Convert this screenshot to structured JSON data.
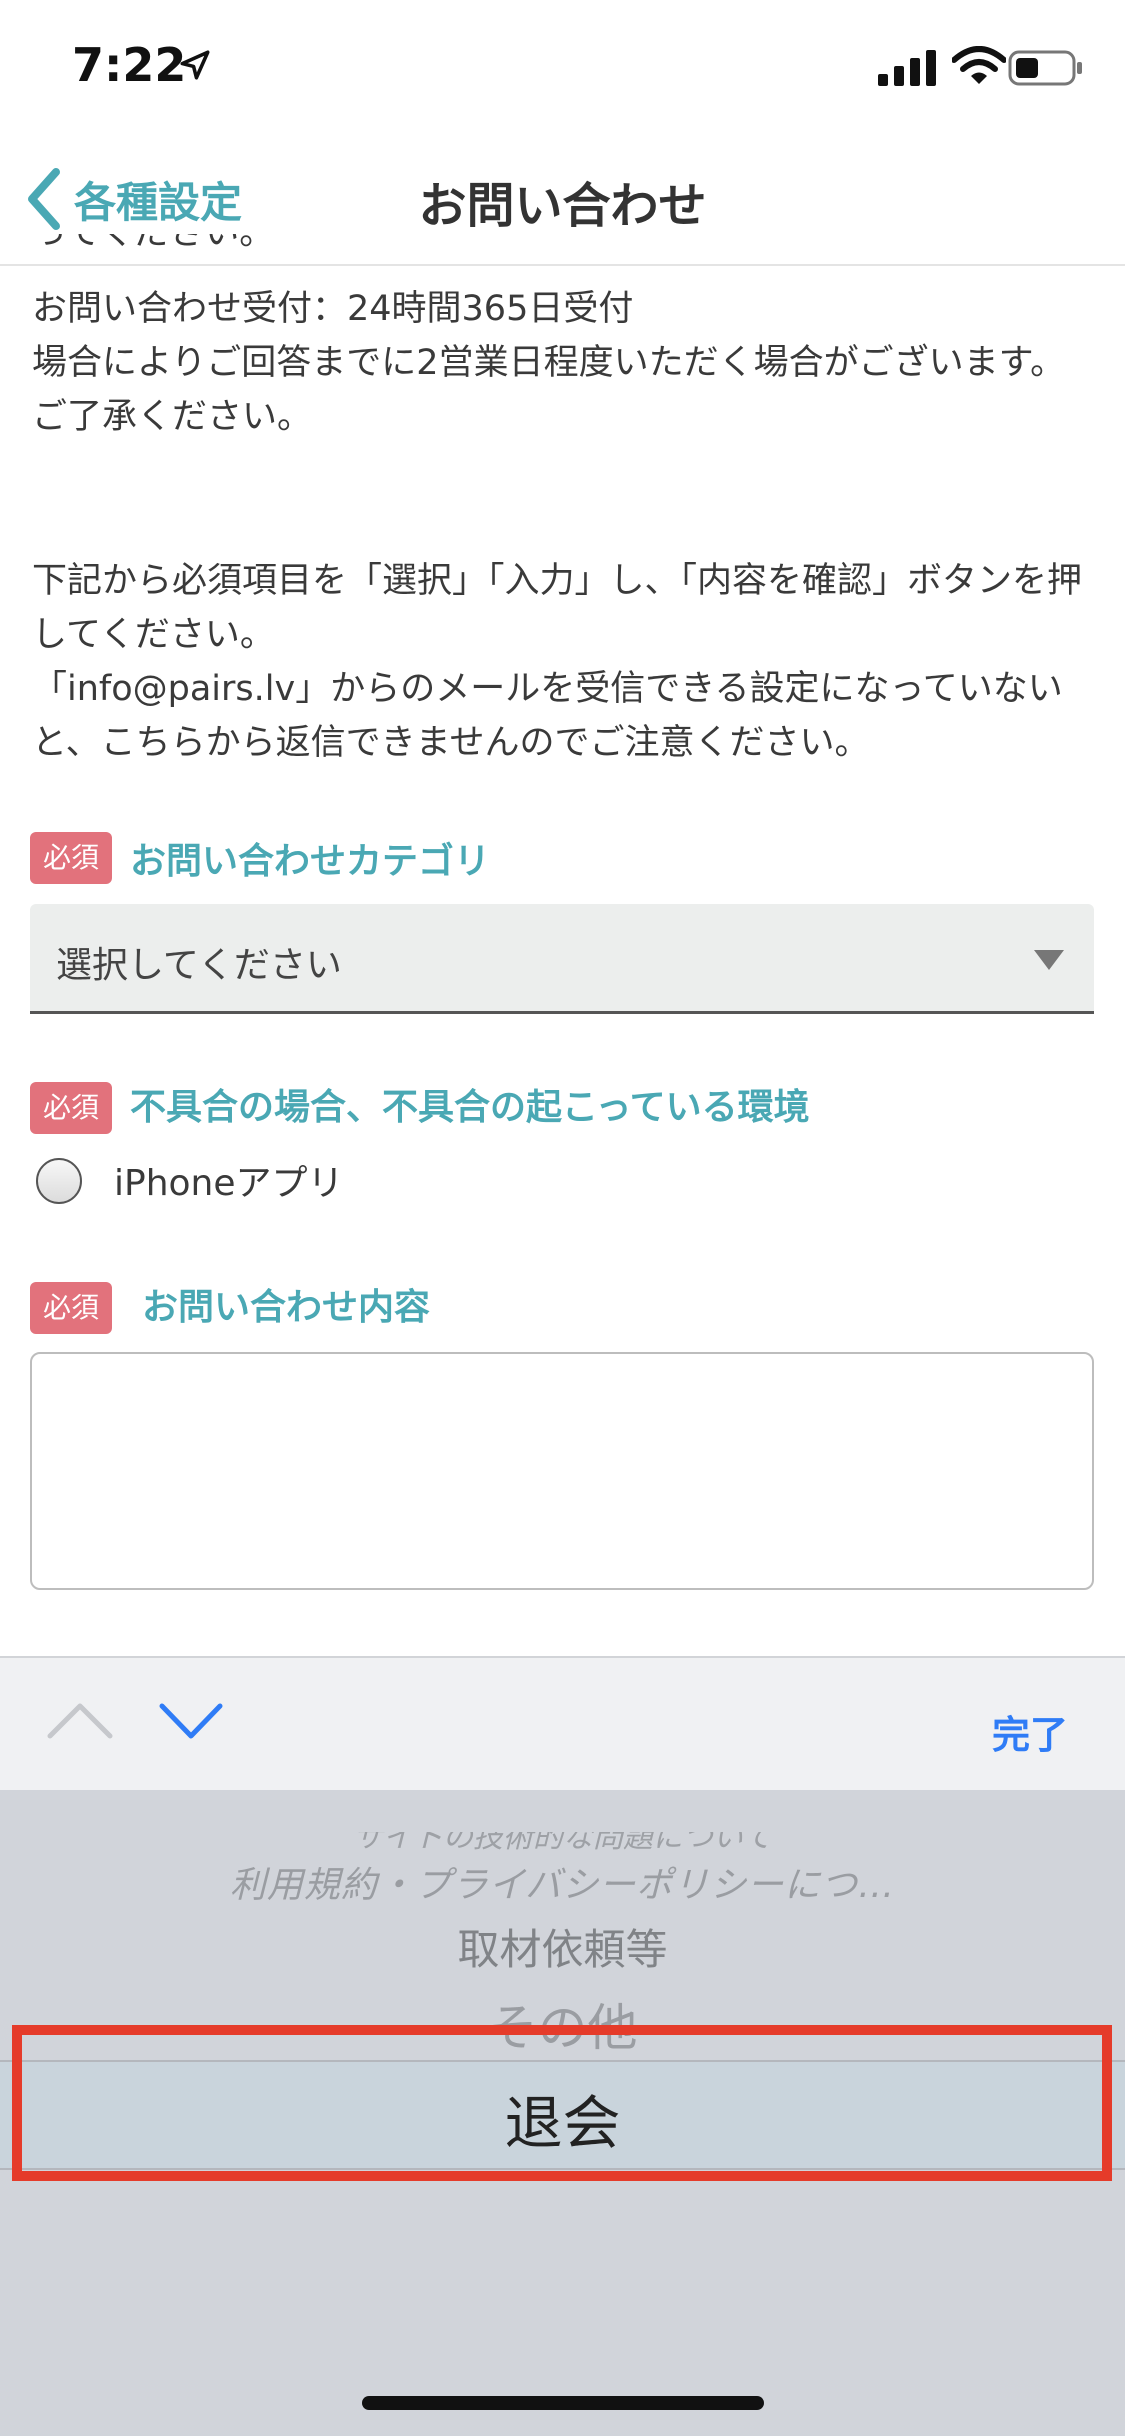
{
  "status_bar": {
    "time": "7:22",
    "icons": [
      "location-arrow-icon",
      "cellular-signal-icon",
      "wifi-icon",
      "battery-icon"
    ]
  },
  "nav": {
    "back_label": "各種設定",
    "title": "お問い合わせ",
    "back_icon": "chevron-left-icon"
  },
  "intro": {
    "cut_line": "ってください。",
    "line1": "お問い合わせ受付：24時間365日受付",
    "line2": "場合によりご回答までに2営業日程度いただく場合がございます。ご了承ください。",
    "paragraph2": "下記から必須項目を「選択」「入力」し、「内容を確認」ボタンを押してください。",
    "paragraph3": "「info@pairs.lv」からのメールを受信できる設定になっていないと、こちらから返信できませんのでご注意ください。"
  },
  "form": {
    "required_badge": "必須",
    "category": {
      "label": "お問い合わせカテゴリ",
      "selected_value": "選択してください"
    },
    "environment": {
      "label": "不具合の場合、不具合の起こっている環境",
      "option_label": "iPhoneアプリ"
    },
    "content": {
      "label": "お問い合わせ内容",
      "value": ""
    }
  },
  "keyboard_accessory": {
    "done_label": "完了",
    "prev_icon": "chevron-up-icon",
    "next_icon": "chevron-down-icon"
  },
  "picker": {
    "options": [
      "サイトの技術的な問題について",
      "利用規約・プライバシーポリシーにつ…",
      "取材依頼等",
      "その他",
      "退会"
    ],
    "selected": "退会"
  },
  "colors": {
    "accent": "#4aa8b4",
    "required_badge": "#e2727c",
    "done_blue": "#2f7cf6",
    "highlight": "#e53b2a"
  }
}
